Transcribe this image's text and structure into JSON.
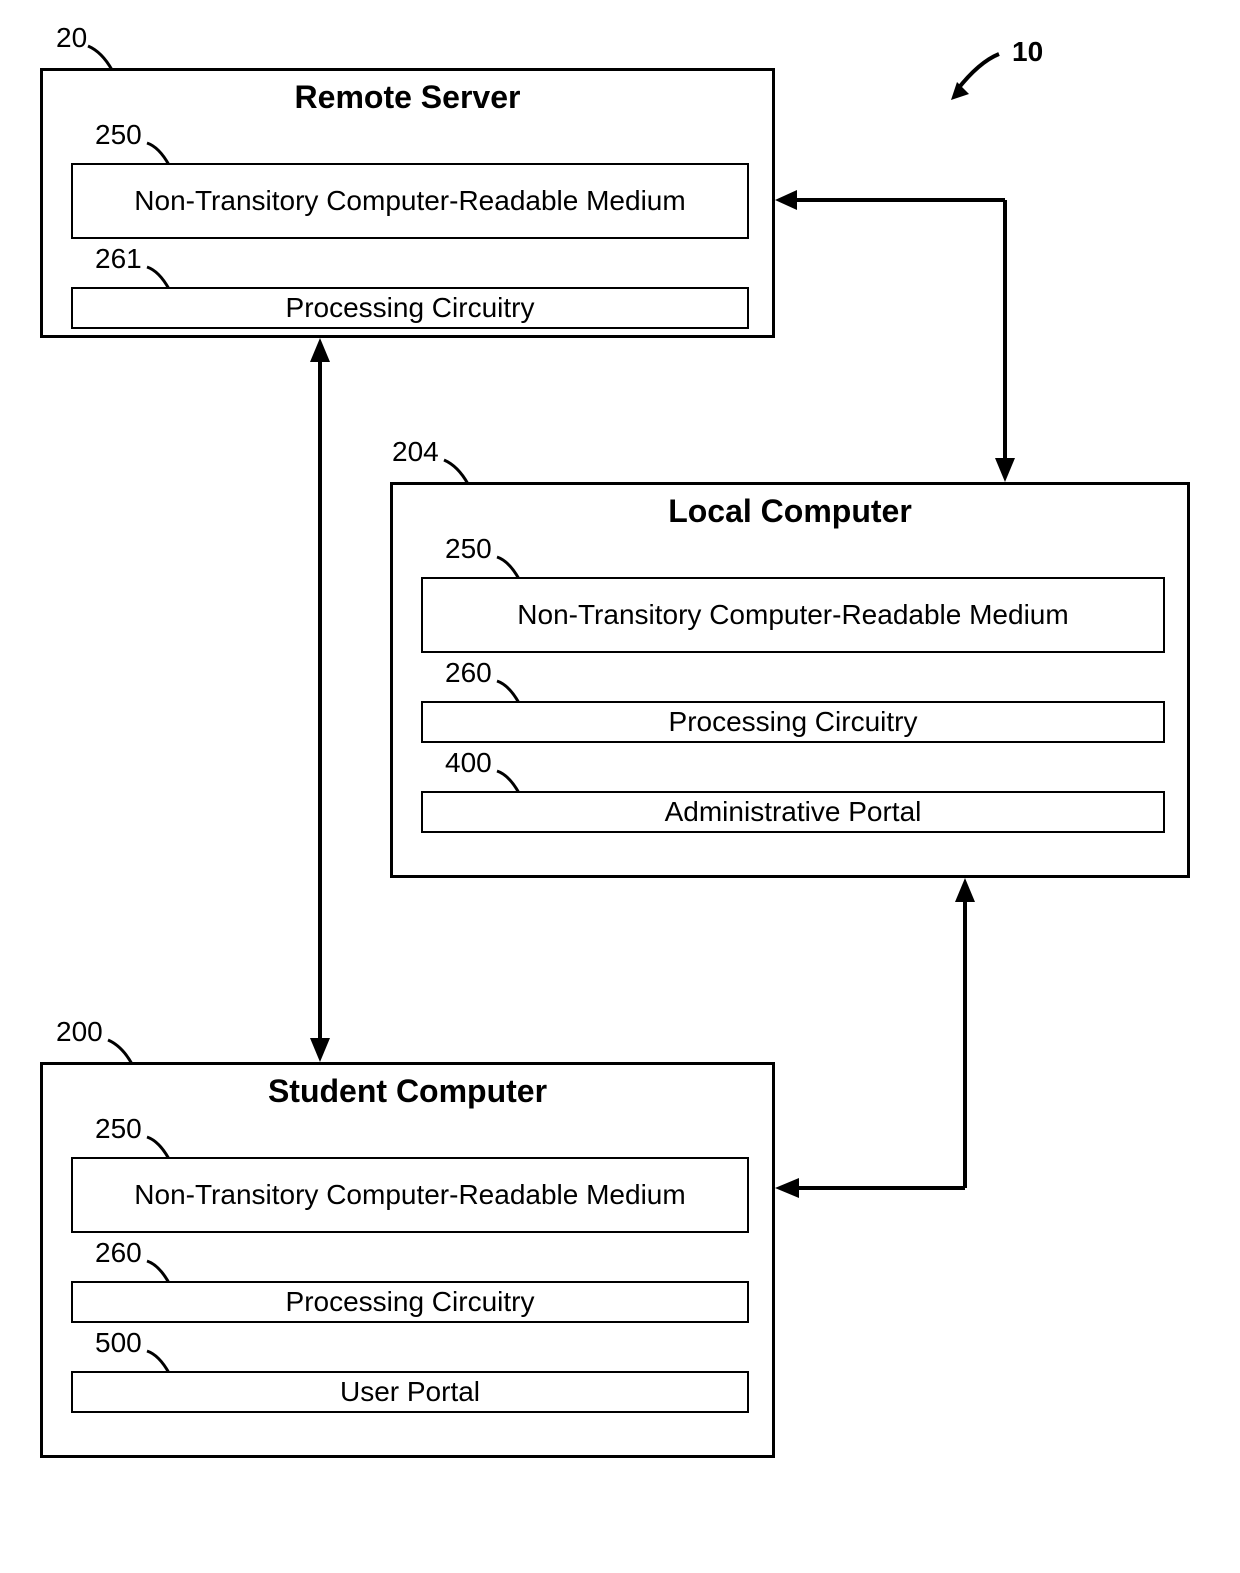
{
  "figure_ref": "10",
  "boxes": {
    "remote_server": {
      "ref": "20",
      "title": "Remote Server",
      "items": [
        {
          "ref": "250",
          "label": "Non-Transitory Computer-Readable Medium"
        },
        {
          "ref": "261",
          "label": "Processing Circuitry"
        }
      ]
    },
    "local_computer": {
      "ref": "204",
      "title": "Local Computer",
      "items": [
        {
          "ref": "250",
          "label": "Non-Transitory Computer-Readable Medium"
        },
        {
          "ref": "260",
          "label": "Processing Circuitry"
        },
        {
          "ref": "400",
          "label": "Administrative Portal"
        }
      ]
    },
    "student_computer": {
      "ref": "200",
      "title": "Student Computer",
      "items": [
        {
          "ref": "250",
          "label": "Non-Transitory Computer-Readable Medium"
        },
        {
          "ref": "260",
          "label": "Processing Circuitry"
        },
        {
          "ref": "500",
          "label": "User Portal"
        }
      ]
    }
  }
}
